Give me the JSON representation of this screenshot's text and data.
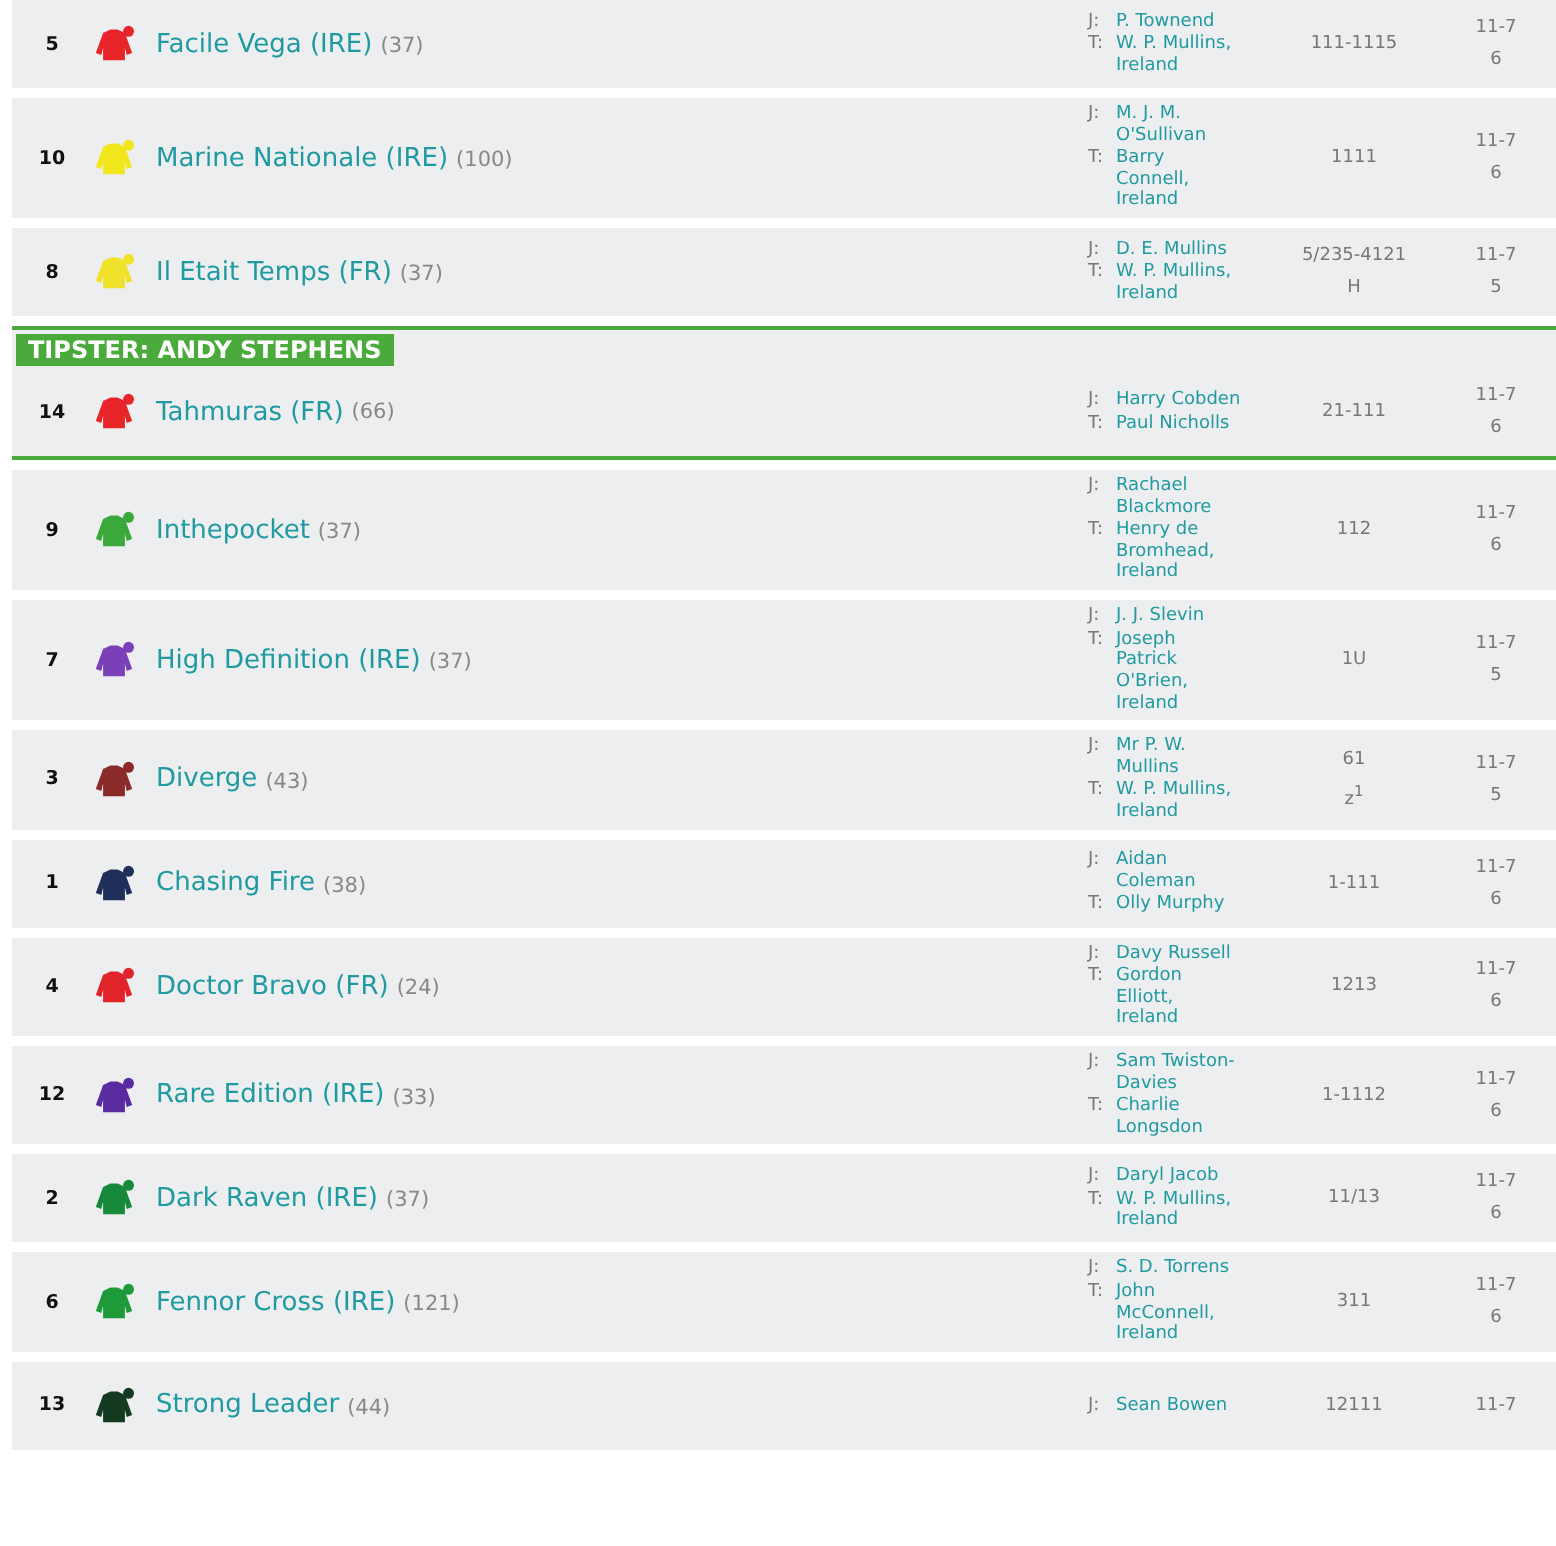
{
  "runners": [
    {
      "number": "5",
      "name": "Facile Vega (IRE)",
      "rating": "(37)",
      "color": "#e8262a",
      "jockey_label": "J:",
      "jockey": [
        "P. Townend"
      ],
      "trainer_label": "T:",
      "trainer": [
        "W. P. Mullins,",
        "Ireland"
      ],
      "form": [
        "111-1115"
      ],
      "weight": "11-7",
      "age": "6"
    },
    {
      "number": "10",
      "name": "Marine Nationale (IRE)",
      "rating": "(100)",
      "color": "#f2e61c",
      "jockey_label": "J:",
      "jockey": [
        "M. J. M.",
        "O'Sullivan"
      ],
      "trainer_label": "T:",
      "trainer": [
        "Barry",
        "Connell,",
        "Ireland"
      ],
      "form": [
        "1111"
      ],
      "weight": "11-7",
      "age": "6"
    },
    {
      "number": "8",
      "name": "Il Etait Temps (FR)",
      "rating": "(37)",
      "color": "#f0e22a",
      "jockey_label": "J:",
      "jockey": [
        "D. E. Mullins"
      ],
      "trainer_label": "T:",
      "trainer": [
        "W. P. Mullins,",
        "Ireland"
      ],
      "form": [
        "5/235-4121",
        "H"
      ],
      "weight": "11-7",
      "age": "5"
    },
    {
      "number": "14",
      "name": "Tahmuras (FR)",
      "rating": "(66)",
      "color": "#e8262a",
      "jockey_label": "J:",
      "jockey": [
        "Harry Cobden"
      ],
      "trainer_label": "T:",
      "trainer": [
        "Paul Nicholls"
      ],
      "form": [
        "21-111"
      ],
      "weight": "11-7",
      "age": "6",
      "tipster": "TIPSTER: ANDY STEPHENS"
    },
    {
      "number": "9",
      "name": "Inthepocket",
      "rating": "(37)",
      "color": "#3aa83a",
      "jockey_label": "J:",
      "jockey": [
        "Rachael",
        "Blackmore"
      ],
      "trainer_label": "T:",
      "trainer": [
        "Henry de",
        "Bromhead,",
        "Ireland"
      ],
      "form": [
        "112"
      ],
      "weight": "11-7",
      "age": "6"
    },
    {
      "number": "7",
      "name": "High Definition (IRE)",
      "rating": "(37)",
      "color": "#7b3fb8",
      "jockey_label": "J:",
      "jockey": [
        "J. J. Slevin"
      ],
      "trainer_label": "T:",
      "trainer": [
        "Joseph",
        "Patrick",
        "O'Brien,",
        "Ireland"
      ],
      "form": [
        "1U"
      ],
      "weight": "11-7",
      "age": "5"
    },
    {
      "number": "3",
      "name": "Diverge",
      "rating": "(43)",
      "color": "#8a2a2a",
      "jockey_label": "J:",
      "jockey": [
        "Mr P. W.",
        "Mullins"
      ],
      "trainer_label": "T:",
      "trainer": [
        "W. P. Mullins,",
        "Ireland"
      ],
      "form": [
        "61",
        "z$^{1}$"
      ],
      "weight": "11-7",
      "age": "5"
    },
    {
      "number": "1",
      "name": "Chasing Fire",
      "rating": "(38)",
      "color": "#1f2f5a",
      "jockey_label": "J:",
      "jockey": [
        "Aidan",
        "Coleman"
      ],
      "trainer_label": "T:",
      "trainer": [
        "Olly Murphy"
      ],
      "form": [
        "1-111"
      ],
      "weight": "11-7",
      "age": "6"
    },
    {
      "number": "4",
      "name": "Doctor Bravo (FR)",
      "rating": "(24)",
      "color": "#e0242a",
      "jockey_label": "J:",
      "jockey": [
        "Davy Russell"
      ],
      "trainer_label": "T:",
      "trainer": [
        "Gordon",
        "Elliott,",
        "Ireland"
      ],
      "form": [
        "1213"
      ],
      "weight": "11-7",
      "age": "6"
    },
    {
      "number": "12",
      "name": "Rare Edition (IRE)",
      "rating": "(33)",
      "color": "#5a2aa0",
      "jockey_label": "J:",
      "jockey": [
        "Sam Twiston-",
        "Davies"
      ],
      "trainer_label": "T:",
      "trainer": [
        "Charlie",
        "Longsdon"
      ],
      "form": [
        "1-1112"
      ],
      "weight": "11-7",
      "age": "6"
    },
    {
      "number": "2",
      "name": "Dark Raven (IRE)",
      "rating": "(37)",
      "color": "#168a3a",
      "jockey_label": "J:",
      "jockey": [
        "Daryl Jacob"
      ],
      "trainer_label": "T:",
      "trainer": [
        "W. P. Mullins,",
        "Ireland"
      ],
      "form": [
        "11/13"
      ],
      "weight": "11-7",
      "age": "6"
    },
    {
      "number": "6",
      "name": "Fennor Cross (IRE)",
      "rating": "(121)",
      "color": "#1f9a3a",
      "jockey_label": "J:",
      "jockey": [
        "S. D. Torrens"
      ],
      "trainer_label": "T:",
      "trainer": [
        "John",
        "McConnell,",
        "Ireland"
      ],
      "form": [
        "311"
      ],
      "weight": "11-7",
      "age": "6"
    },
    {
      "number": "13",
      "name": "Strong Leader",
      "rating": "(44)",
      "color": "#143a22",
      "jockey_label": "J:",
      "jockey": [
        "Sean Bowen"
      ],
      "form": [
        "12111"
      ],
      "weight": "11-7"
    }
  ]
}
